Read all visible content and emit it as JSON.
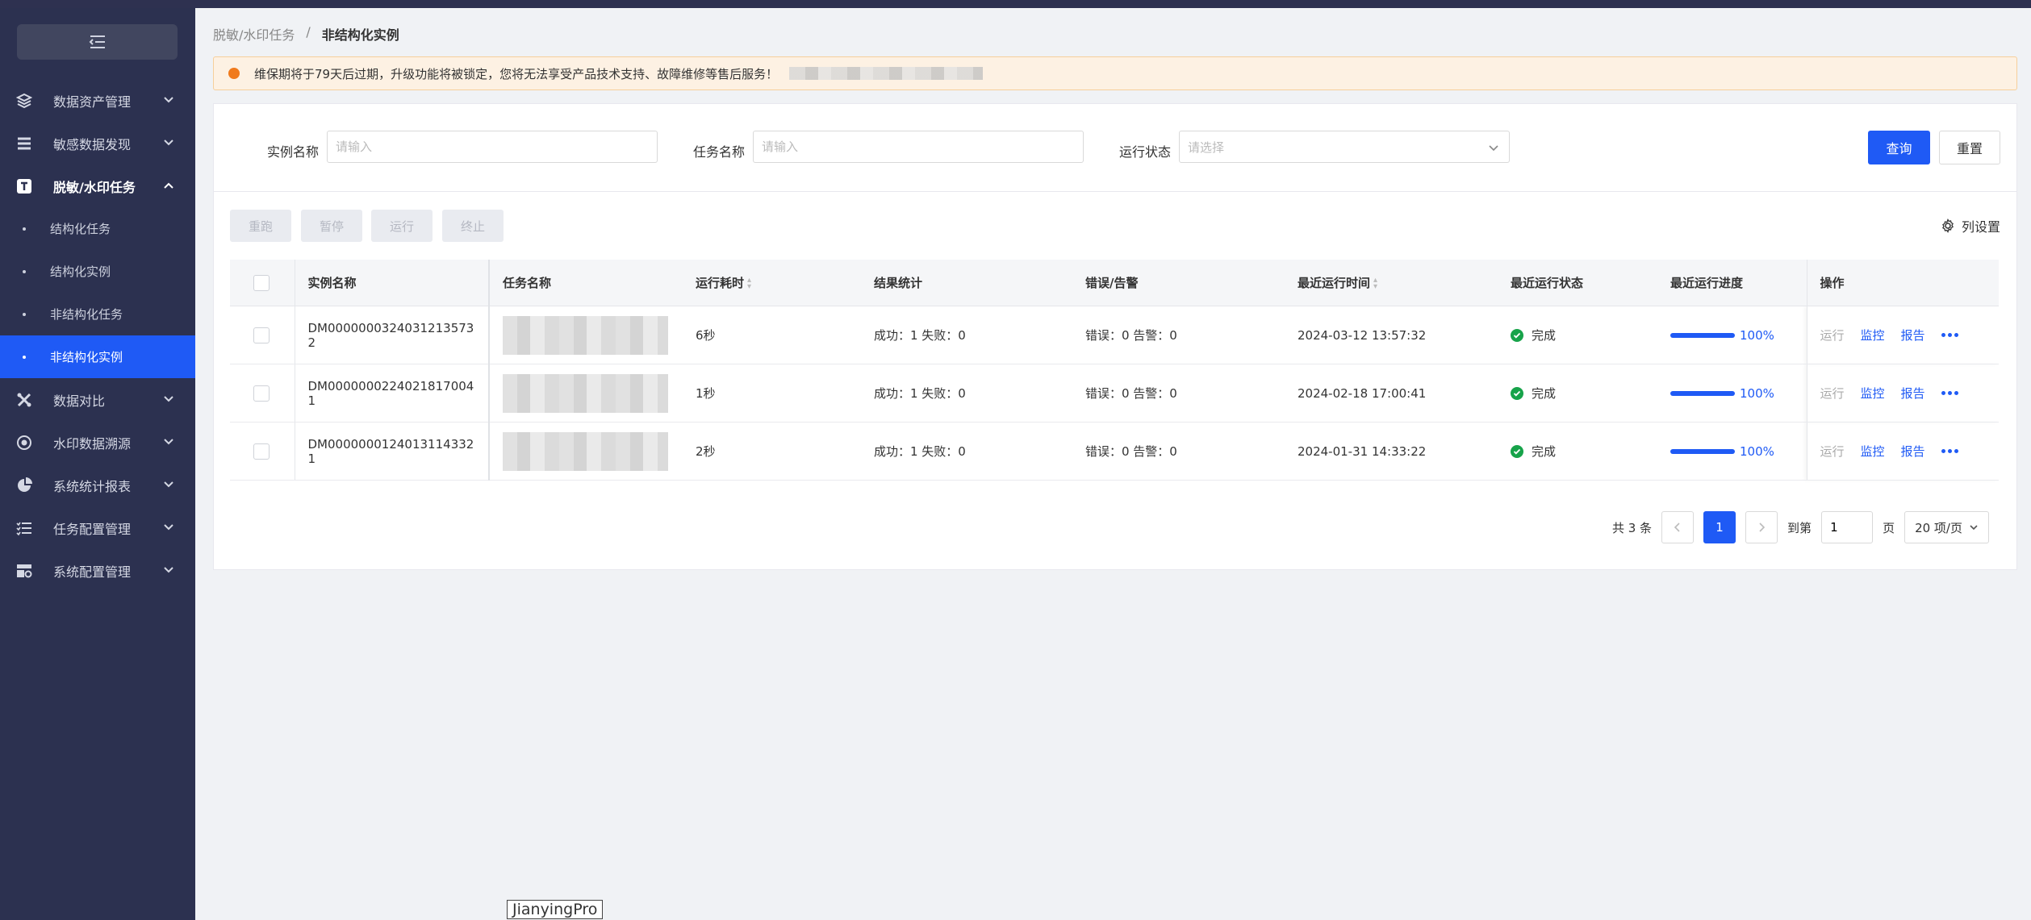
{
  "sidebar": {
    "items": [
      {
        "label": "数据资产管理",
        "icon": "layers-icon"
      },
      {
        "label": "敏感数据发现",
        "icon": "list-icon"
      },
      {
        "label": "脱敏/水印任务",
        "icon": "text-icon",
        "open": true,
        "children": [
          {
            "label": "结构化任务"
          },
          {
            "label": "结构化实例"
          },
          {
            "label": "非结构化任务"
          },
          {
            "label": "非结构化实例",
            "active": true
          }
        ]
      },
      {
        "label": "数据对比",
        "icon": "compare-icon"
      },
      {
        "label": "水印数据溯源",
        "icon": "target-icon"
      },
      {
        "label": "系统统计报表",
        "icon": "pie-chart-icon"
      },
      {
        "label": "任务配置管理",
        "icon": "checklist-icon"
      },
      {
        "label": "系统配置管理",
        "icon": "settings-table-icon"
      }
    ]
  },
  "breadcrumb": {
    "parent": "脱敏/水印任务",
    "separator": "/",
    "current": "非结构化实例"
  },
  "alert": {
    "message": "维保期将于79天后过期，升级功能将被锁定，您将无法享受产品技术支持、故障维修等售后服务！"
  },
  "filters": {
    "instance_name": {
      "label": "实例名称",
      "placeholder": "请输入"
    },
    "task_name": {
      "label": "任务名称",
      "placeholder": "请输入"
    },
    "run_status": {
      "label": "运行状态",
      "placeholder": "请选择"
    },
    "query_label": "查询",
    "reset_label": "重置"
  },
  "toolbar": {
    "rerun": "重跑",
    "pause": "暂停",
    "run": "运行",
    "stop": "终止",
    "column_settings": "列设置"
  },
  "table": {
    "columns": {
      "instance": "实例名称",
      "task": "任务名称",
      "duration": "运行耗时",
      "result": "结果统计",
      "errors": "错误/告警",
      "last_time": "最近运行时间",
      "last_status": "最近运行状态",
      "last_progress": "最近运行进度",
      "ops": "操作"
    },
    "rows": [
      {
        "instance_l1": "DM0000000324031213573",
        "instance_l2": "2",
        "duration": "6秒",
        "result": "成功：1 失败：0",
        "errors": "错误：0 告警：0",
        "time": "2024-03-12 13:57:32",
        "status": "完成",
        "progress": "100%"
      },
      {
        "instance_l1": "DM0000000224021817004",
        "instance_l2": "1",
        "duration": "1秒",
        "result": "成功：1 失败：0",
        "errors": "错误：0 告警：0",
        "time": "2024-02-18 17:00:41",
        "status": "完成",
        "progress": "100%"
      },
      {
        "instance_l1": "DM0000000124013114332",
        "instance_l2": "1",
        "duration": "2秒",
        "result": "成功：1 失败：0",
        "errors": "错误：0 告警：0",
        "time": "2024-01-31 14:33:22",
        "status": "完成",
        "progress": "100%"
      }
    ],
    "ops": {
      "run": "运行",
      "monitor": "监控",
      "report": "报告"
    }
  },
  "pagination": {
    "total": "共 3 条",
    "current_page": "1",
    "goto_label": "到第",
    "goto_value": "1",
    "page_unit": "页",
    "page_size": "20 项/页"
  },
  "watermark_tag": "JianyingPro",
  "colors": {
    "primary": "#1f5af5",
    "sidebar_bg": "#2c3150",
    "success": "#17a34a",
    "warning_dot": "#f07a1c"
  }
}
